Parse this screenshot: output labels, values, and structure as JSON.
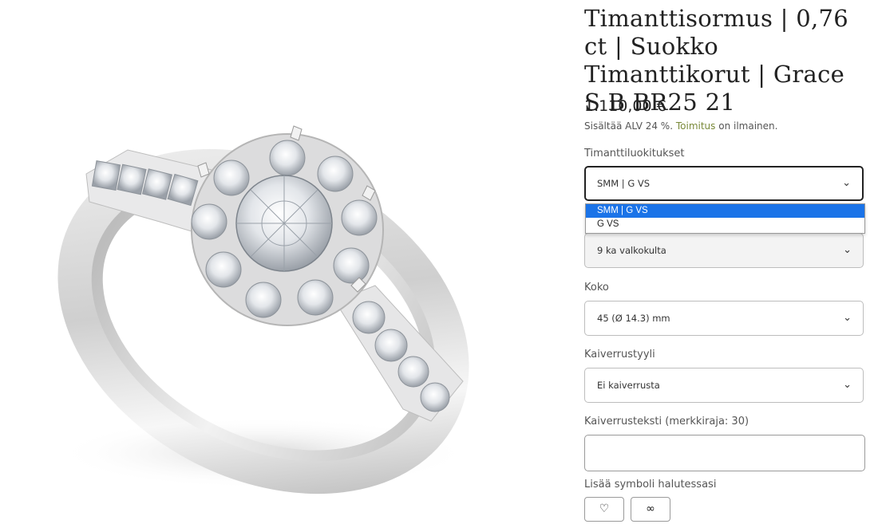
{
  "product": {
    "title": "Timanttisormus | 0,76 ct | Suokko Timanttikorut | Grace S B BR25 21",
    "price": "1.110,00 €",
    "tax_prefix": "Sisältää ALV 24 %.",
    "tax_link": "Toimitus",
    "tax_suffix": "on ilmainen."
  },
  "options": {
    "diamond_grade": {
      "label": "Timanttiluokitukset",
      "value": "SMM | G VS",
      "dropdown_open": true,
      "choices": [
        "SMM | G VS",
        "G VS"
      ],
      "selected_index": 0
    },
    "metal": {
      "value": "9 ka valkokulta"
    },
    "size": {
      "label": "Koko",
      "value": "45 (Ø 14.3) mm"
    },
    "engraving_style": {
      "label": "Kaiverrustyyli",
      "value": "Ei kaiverrusta"
    },
    "engraving_text": {
      "label": "Kaiverrusteksti (merkkiraja: 30)",
      "value": ""
    },
    "symbols": {
      "label": "Lisää symboli halutessasi",
      "items": [
        "♡",
        "∞"
      ]
    }
  },
  "colors": {
    "accent_link": "#7a8a3a",
    "dropdown_highlight": "#1a73e8"
  }
}
